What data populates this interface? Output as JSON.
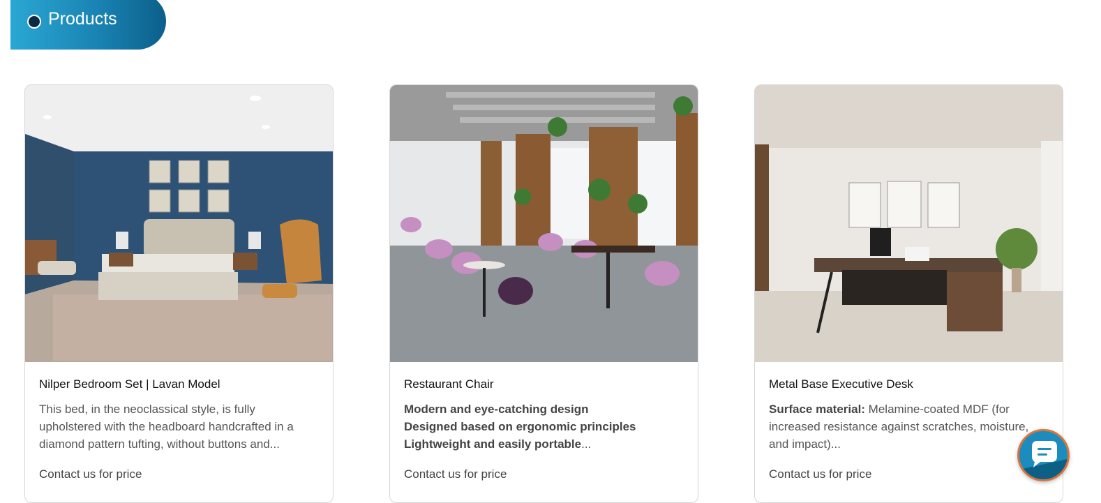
{
  "section": {
    "title": "Products"
  },
  "products": [
    {
      "title": "Nilper Bedroom Set | Lavan Model",
      "desc": "This bed, in the neoclassical style, is fully upholstered with the headboard handcrafted in a diamond pattern tufting, without buttons and...",
      "price": "Contact us for price",
      "image_alt": "bedroom with blue wall, upholstered bed and armchair"
    },
    {
      "title": "Restaurant Chair",
      "desc_lines": [
        "Modern and eye-catching design",
        "Designed based on ergonomic principles",
        "Lightweight and easily portable"
      ],
      "desc_suffix": "...",
      "price": "Contact us for price",
      "image_alt": "restaurant interior with pink chairs and tables"
    },
    {
      "title": "Metal Base Executive Desk",
      "desc_label": "Surface material:",
      "desc": " Melamine-coated MDF (for increased resistance against scratches, moisture, and impact)...",
      "price": "Contact us for price",
      "image_alt": "office with L-shaped executive desk and chair"
    }
  ],
  "chat": {
    "icon": "chat-bubble-icon"
  }
}
